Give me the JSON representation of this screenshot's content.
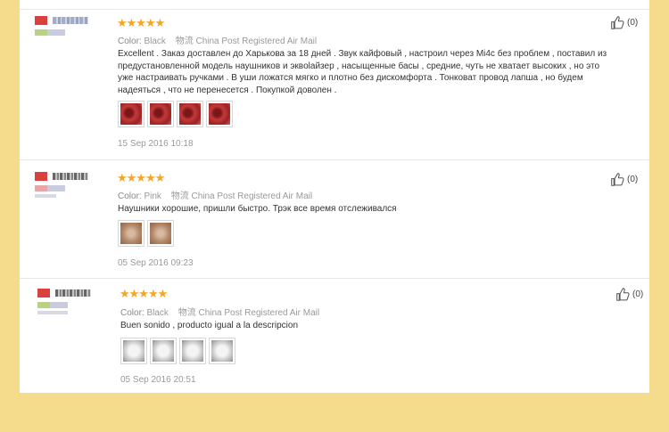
{
  "reviews": [
    {
      "rating": "★★★★★",
      "color_label": "Color:",
      "color_value": "Black",
      "shipping": "物流 China Post Registered Air Mail",
      "text": "Excellent . Заказ доставлен до Харькова за 18 дней . Звук кайфовый , настроил через Mi4c без проблем , поставил из предустановленной модель наушников и эквolайзер , насыщенные басы , средние, чуть не хватает высоких , но это уже настраивать ручками . В уши ложатся мягко и плотно без дискомфорта . Тонковат провод лапша , но будем надеяться , что не перенесется . Покупкой доволен .",
      "photos": [
        "red",
        "red",
        "red",
        "red"
      ],
      "date": "15 Sep 2016 10:18",
      "likes": "(0)"
    },
    {
      "rating": "★★★★★",
      "color_label": "Color:",
      "color_value": "Pink",
      "shipping": "物流 China Post Registered Air Mail",
      "text": "Наушники хорошие, пришли быстро. Трэк все время отслеживался",
      "photos": [
        "tan",
        "tan"
      ],
      "date": "05 Sep 2016 09:23",
      "likes": "(0)"
    },
    {
      "rating": "★★★★★",
      "color_label": "Color:",
      "color_value": "Black",
      "shipping": "物流 China Post Registered Air Mail",
      "text": "Buen sonido , producto igual a la descripcion",
      "photos": [
        "gray",
        "gray",
        "gray",
        "gray"
      ],
      "date": "05 Sep 2016 20:51",
      "likes": "(0)"
    }
  ]
}
